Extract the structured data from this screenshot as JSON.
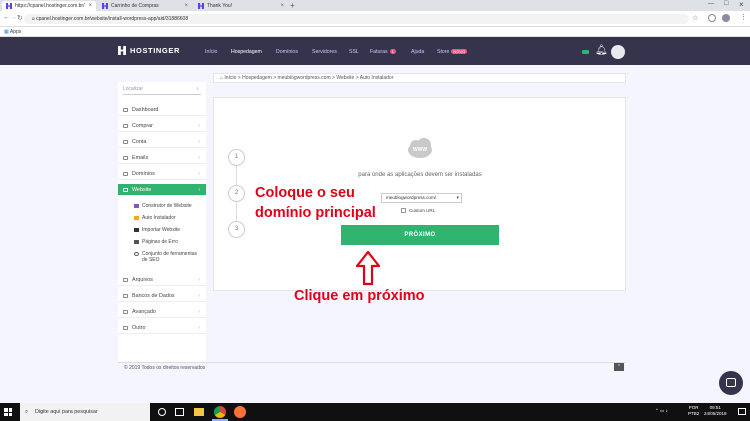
{
  "browser": {
    "tabs": [
      {
        "label": "https://cpanel.hostinger.com.br/",
        "active": true
      },
      {
        "label": "Carrinho de Compras",
        "active": false
      },
      {
        "label": "Thank You!",
        "active": false
      }
    ],
    "new_tab": "+",
    "url": "cpanel.hostinger.com.br/website/install-wordpress-app/aid/31886608",
    "bookmarks_label": "Apps"
  },
  "header": {
    "brand": "HOSTINGER",
    "nav": [
      {
        "label": "Início"
      },
      {
        "label": "Hospedagem"
      },
      {
        "label": "Domínios"
      },
      {
        "label": "Servidores"
      },
      {
        "label": "SSL"
      },
      {
        "label": "Faturas",
        "badge": "1"
      },
      {
        "label": "Ajuda"
      },
      {
        "label": "Store",
        "badge": "NOVO"
      }
    ]
  },
  "sidebar": {
    "search_placeholder": "Localizar",
    "items": [
      {
        "label": "Dashboard"
      },
      {
        "label": "Comprar"
      },
      {
        "label": "Conta"
      },
      {
        "label": "Emails"
      },
      {
        "label": "Domínios"
      },
      {
        "label": "Website"
      },
      {
        "label": "Arquivos"
      },
      {
        "label": "Bancos de Dados"
      },
      {
        "label": "Avançado"
      },
      {
        "label": "Outro"
      }
    ],
    "subitems": [
      {
        "label": "Construtor de Website"
      },
      {
        "label": "Auto Instalador"
      },
      {
        "label": "Importar Website"
      },
      {
        "label": "Páginas de Erro"
      },
      {
        "label": "Conjunto de ferramentas de SEO"
      }
    ]
  },
  "breadcrumb": {
    "items": [
      "Início",
      "Hospedagem",
      "meublogwordpress.com",
      "Website",
      "Auto Instalador"
    ],
    "separator": ">"
  },
  "installer": {
    "steps": [
      "1",
      "2",
      "3"
    ],
    "icon_label": "WWW",
    "description": "para onde as aplicações devem ser instaladas",
    "domain_value": "meublogwordpress.com/",
    "custom_url_label": "Custom URL",
    "next_button": "PRÓXIMO"
  },
  "annotations": {
    "line1": "Coloque o seu",
    "line2": "domínio principal",
    "click": "Clique em próximo"
  },
  "footer": {
    "copyright": "© 2019 Todos os direitos reservados"
  },
  "taskbar": {
    "search_placeholder": "Digite aqui para pesquisar",
    "lang": "POR",
    "lang_sub": "PTB2",
    "time": "09:51",
    "date": "24/05/2019"
  },
  "colors": {
    "header_bg": "#36344d",
    "accent_green": "#2fb36e",
    "annotation_red": "#e0001a",
    "brand_purple": "#673de6"
  }
}
